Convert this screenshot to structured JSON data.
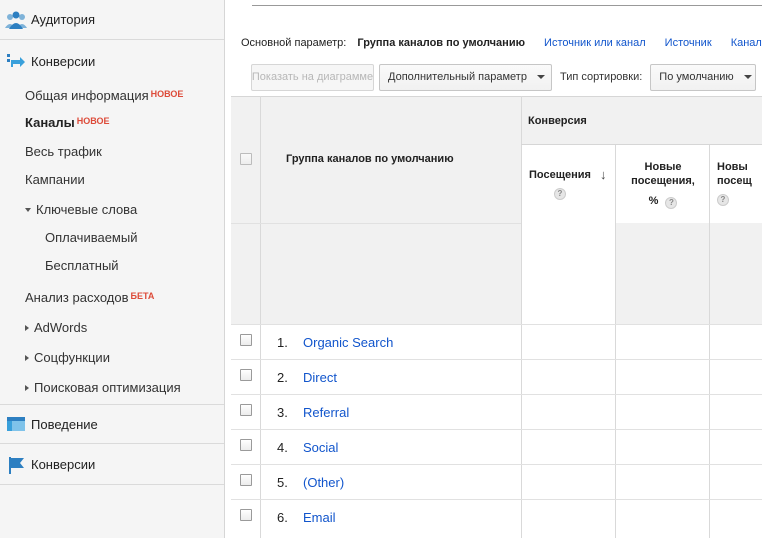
{
  "sidebar": {
    "audience": "Аудитория",
    "conversions_top": "Конверсии",
    "items": [
      {
        "label": "Общая информация",
        "tag": "НОВОЕ"
      },
      {
        "label": "Каналы",
        "tag": "НОВОЕ"
      },
      {
        "label": "Весь трафик"
      },
      {
        "label": "Кампании"
      },
      {
        "label": "Ключевые слова"
      },
      {
        "label": "Оплачиваемый"
      },
      {
        "label": "Бесплатный"
      },
      {
        "label": "Анализ расходов",
        "tag": "БЕТА"
      },
      {
        "label": "AdWords"
      },
      {
        "label": "Соцфункции"
      },
      {
        "label": "Поисковая оптимизация"
      }
    ],
    "behavior": "Поведение",
    "conversions_bottom": "Конверсии"
  },
  "dimension_bar": {
    "label": "Основной параметр:",
    "current": "Группа каналов по умолчанию",
    "links": [
      "Источник или канал",
      "Источник",
      "Канал"
    ]
  },
  "toolbar": {
    "chart_button": "Показать на диаграмме",
    "secondary_dimension": "Дополнительный параметр",
    "sort_label": "Тип сортировки:",
    "sort_value": "По умолчанию"
  },
  "table": {
    "dimension_header": "Группа каналов по умолчанию",
    "group_header": "Конверсия",
    "col_visits": "Посещения",
    "col_new_visits_pct_1": "Новые",
    "col_new_visits_pct_2": "посещения,",
    "col_new_visits_pct_3": "%",
    "col_new_visits_1": "Новы",
    "col_new_visits_2": "посещ",
    "help_glyph": "?",
    "rows": [
      {
        "num": "1.",
        "name": "Organic Search"
      },
      {
        "num": "2.",
        "name": "Direct"
      },
      {
        "num": "3.",
        "name": "Referral"
      },
      {
        "num": "4.",
        "name": "Social"
      },
      {
        "num": "5.",
        "name": "(Other)"
      },
      {
        "num": "6.",
        "name": "Email"
      }
    ]
  },
  "colors": {
    "link": "#1155cc",
    "tag": "#dd4b39",
    "sidebar_bg": "#f5f5f5",
    "header_bg": "#f1f1f1",
    "icon_blue": "#3b98d4"
  }
}
